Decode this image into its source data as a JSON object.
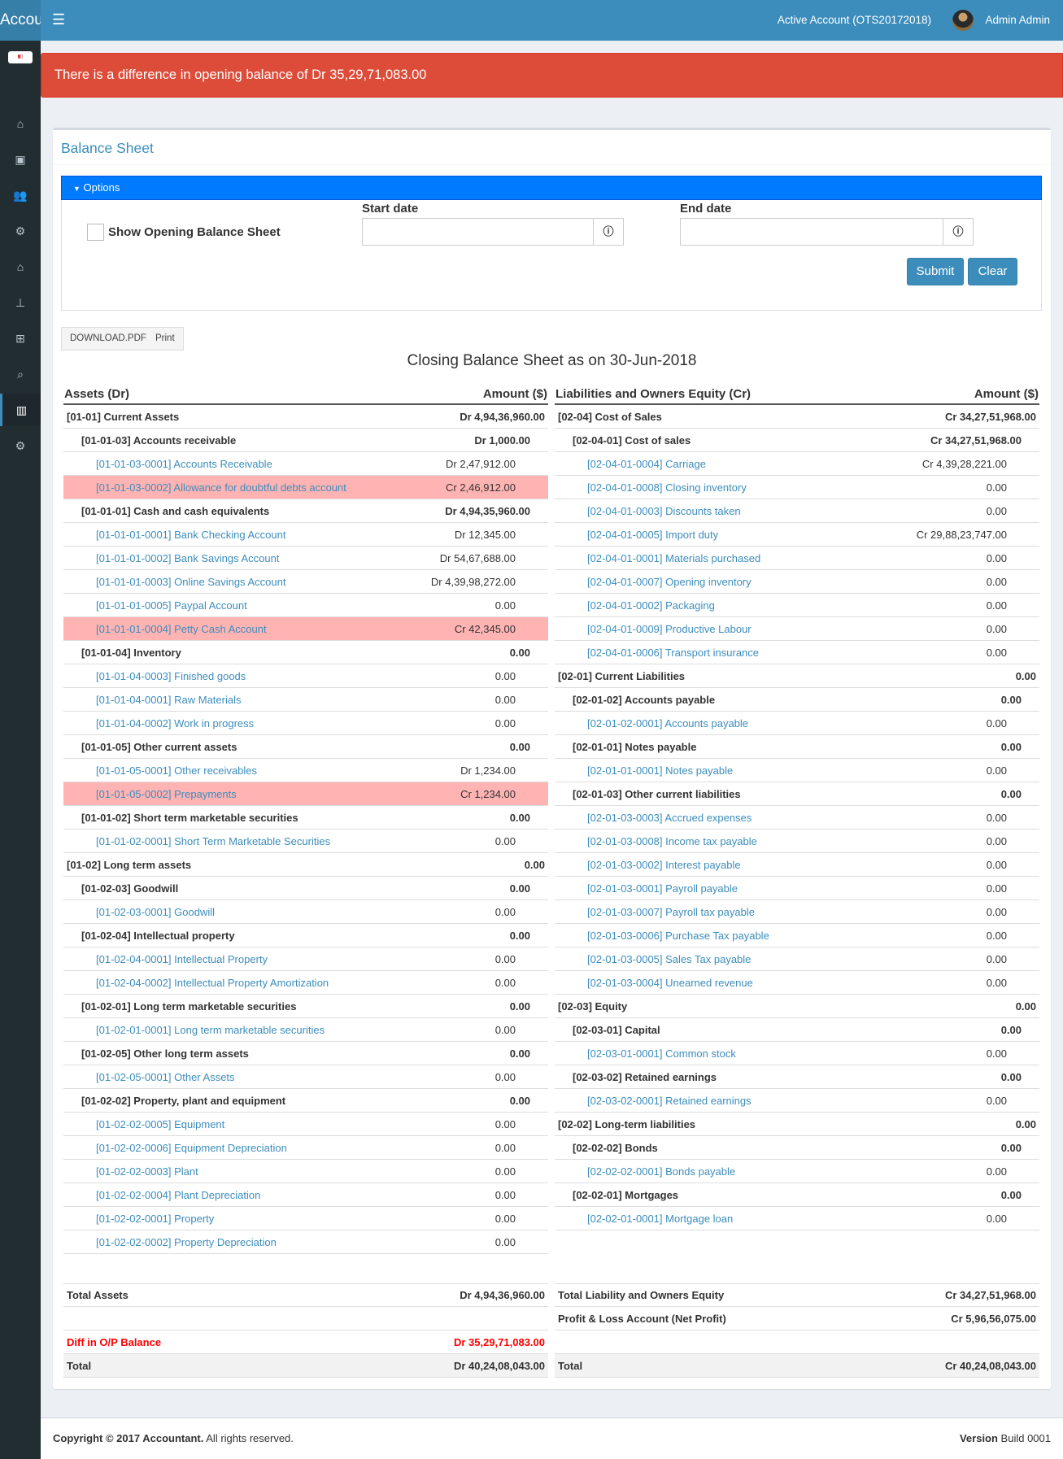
{
  "app": {
    "brand": "Accountant",
    "account": "Active Account (OTS20172018)",
    "user": "Admin Admin",
    "logo_text": "logo"
  },
  "sidebar": {
    "items": [
      {
        "icon": "home-icon",
        "glyph": "⌂"
      },
      {
        "icon": "contacts-icon",
        "glyph": "▣"
      },
      {
        "icon": "users-icon",
        "glyph": "👥"
      },
      {
        "icon": "cogs-icon",
        "glyph": "⚙"
      },
      {
        "icon": "home-icon",
        "glyph": "⌂"
      },
      {
        "icon": "sitemap-icon",
        "glyph": "⊥"
      },
      {
        "icon": "plus-square-icon",
        "glyph": "⊞"
      },
      {
        "icon": "search-icon",
        "glyph": "⌕"
      },
      {
        "icon": "bar-chart-icon",
        "glyph": "▥",
        "active": true
      },
      {
        "icon": "gear-icon",
        "glyph": "⚙"
      }
    ]
  },
  "alert": "There is a difference in opening balance of Dr 35,29,71,083.00",
  "box": {
    "title": "Balance Sheet"
  },
  "options": {
    "label": "Options",
    "show_opening": "Show Opening Balance Sheet",
    "start_label": "Start date",
    "start_value": "",
    "end_label": "End date",
    "end_value": "",
    "submit": "Submit",
    "clear": "Clear"
  },
  "actions": {
    "download": "DOWNLOAD.PDF",
    "print": "Print"
  },
  "sheet_title": "Closing Balance Sheet as on 30-Jun-2018",
  "colors": {
    "accent": "#3c8dbc",
    "alert": "#dd4b39",
    "options": "#007bff",
    "highlight": "#ffb3b3"
  },
  "assets": {
    "header": "Assets (Dr)",
    "amount_header": "Amount ($)",
    "rows": [
      {
        "l": 0,
        "n": "[01-01] Current Assets",
        "a": "Dr 4,94,36,960.00"
      },
      {
        "l": 1,
        "n": "[01-01-03] Accounts receivable",
        "a": "Dr 1,000.00"
      },
      {
        "l": 2,
        "n": "[01-01-03-0001] Accounts Receivable",
        "a": "Dr 2,47,912.00"
      },
      {
        "l": 2,
        "n": "[01-01-03-0002] Allowance for doubtful debts account",
        "a": "Cr 2,46,912.00",
        "hl": true
      },
      {
        "l": 1,
        "n": "[01-01-01] Cash and cash equivalents",
        "a": "Dr 4,94,35,960.00"
      },
      {
        "l": 2,
        "n": "[01-01-01-0001] Bank Checking Account",
        "a": "Dr 12,345.00"
      },
      {
        "l": 2,
        "n": "[01-01-01-0002] Bank Savings Account",
        "a": "Dr 54,67,688.00"
      },
      {
        "l": 2,
        "n": "[01-01-01-0003] Online Savings Account",
        "a": "Dr 4,39,98,272.00"
      },
      {
        "l": 2,
        "n": "[01-01-01-0005] Paypal Account",
        "a": "0.00"
      },
      {
        "l": 2,
        "n": "[01-01-01-0004] Petty Cash Account",
        "a": "Cr 42,345.00",
        "hl": true
      },
      {
        "l": 1,
        "n": "[01-01-04] Inventory",
        "a": "0.00"
      },
      {
        "l": 2,
        "n": "[01-01-04-0003] Finished goods",
        "a": "0.00"
      },
      {
        "l": 2,
        "n": "[01-01-04-0001] Raw Materials",
        "a": "0.00"
      },
      {
        "l": 2,
        "n": "[01-01-04-0002] Work in progress",
        "a": "0.00"
      },
      {
        "l": 1,
        "n": "[01-01-05] Other current assets",
        "a": "0.00"
      },
      {
        "l": 2,
        "n": "[01-01-05-0001] Other receivables",
        "a": "Dr 1,234.00"
      },
      {
        "l": 2,
        "n": "[01-01-05-0002] Prepayments",
        "a": "Cr 1,234.00",
        "hl": true
      },
      {
        "l": 1,
        "n": "[01-01-02] Short term marketable securities",
        "a": "0.00"
      },
      {
        "l": 2,
        "n": "[01-01-02-0001] Short Term Marketable Securities",
        "a": "0.00"
      },
      {
        "l": 0,
        "n": "[01-02] Long term assets",
        "a": "0.00"
      },
      {
        "l": 1,
        "n": "[01-02-03] Goodwill",
        "a": "0.00"
      },
      {
        "l": 2,
        "n": "[01-02-03-0001] Goodwill",
        "a": "0.00"
      },
      {
        "l": 1,
        "n": "[01-02-04] Intellectual property",
        "a": "0.00"
      },
      {
        "l": 2,
        "n": "[01-02-04-0001] Intellectual Property",
        "a": "0.00"
      },
      {
        "l": 2,
        "n": "[01-02-04-0002] Intellectual Property Amortization",
        "a": "0.00"
      },
      {
        "l": 1,
        "n": "[01-02-01] Long term marketable securities",
        "a": "0.00"
      },
      {
        "l": 2,
        "n": "[01-02-01-0001] Long term marketable securities",
        "a": "0.00"
      },
      {
        "l": 1,
        "n": "[01-02-05] Other long term assets",
        "a": "0.00"
      },
      {
        "l": 2,
        "n": "[01-02-05-0001] Other Assets",
        "a": "0.00"
      },
      {
        "l": 1,
        "n": "[01-02-02] Property, plant and equipment",
        "a": "0.00"
      },
      {
        "l": 2,
        "n": "[01-02-02-0005] Equipment",
        "a": "0.00"
      },
      {
        "l": 2,
        "n": "[01-02-02-0006] Equipment Depreciation",
        "a": "0.00"
      },
      {
        "l": 2,
        "n": "[01-02-02-0003] Plant",
        "a": "0.00"
      },
      {
        "l": 2,
        "n": "[01-02-02-0004] Plant Depreciation",
        "a": "0.00"
      },
      {
        "l": 2,
        "n": "[01-02-02-0001] Property",
        "a": "0.00"
      },
      {
        "l": 2,
        "n": "[01-02-02-0002] Property Depreciation",
        "a": "0.00"
      }
    ]
  },
  "liabilities": {
    "header": "Liabilities and Owners Equity (Cr)",
    "amount_header": "Amount ($)",
    "rows": [
      {
        "l": 0,
        "n": "[02-04] Cost of Sales",
        "a": "Cr 34,27,51,968.00"
      },
      {
        "l": 1,
        "n": "[02-04-01] Cost of sales",
        "a": "Cr 34,27,51,968.00"
      },
      {
        "l": 2,
        "n": "[02-04-01-0004] Carriage",
        "a": "Cr 4,39,28,221.00"
      },
      {
        "l": 2,
        "n": "[02-04-01-0008] Closing inventory",
        "a": "0.00"
      },
      {
        "l": 2,
        "n": "[02-04-01-0003] Discounts taken",
        "a": "0.00"
      },
      {
        "l": 2,
        "n": "[02-04-01-0005] Import duty",
        "a": "Cr 29,88,23,747.00"
      },
      {
        "l": 2,
        "n": "[02-04-01-0001] Materials purchased",
        "a": "0.00"
      },
      {
        "l": 2,
        "n": "[02-04-01-0007] Opening inventory",
        "a": "0.00"
      },
      {
        "l": 2,
        "n": "[02-04-01-0002] Packaging",
        "a": "0.00"
      },
      {
        "l": 2,
        "n": "[02-04-01-0009] Productive Labour",
        "a": "0.00"
      },
      {
        "l": 2,
        "n": "[02-04-01-0006] Transport insurance",
        "a": "0.00"
      },
      {
        "l": 0,
        "n": "[02-01] Current Liabilities",
        "a": "0.00"
      },
      {
        "l": 1,
        "n": "[02-01-02] Accounts payable",
        "a": "0.00"
      },
      {
        "l": 2,
        "n": "[02-01-02-0001] Accounts payable",
        "a": "0.00"
      },
      {
        "l": 1,
        "n": "[02-01-01] Notes payable",
        "a": "0.00"
      },
      {
        "l": 2,
        "n": "[02-01-01-0001] Notes payable",
        "a": "0.00"
      },
      {
        "l": 1,
        "n": "[02-01-03] Other current liabilities",
        "a": "0.00"
      },
      {
        "l": 2,
        "n": "[02-01-03-0003] Accrued expenses",
        "a": "0.00"
      },
      {
        "l": 2,
        "n": "[02-01-03-0008] Income tax payable",
        "a": "0.00"
      },
      {
        "l": 2,
        "n": "[02-01-03-0002] Interest payable",
        "a": "0.00"
      },
      {
        "l": 2,
        "n": "[02-01-03-0001] Payroll payable",
        "a": "0.00"
      },
      {
        "l": 2,
        "n": "[02-01-03-0007] Payroll tax payable",
        "a": "0.00"
      },
      {
        "l": 2,
        "n": "[02-01-03-0006] Purchase Tax payable",
        "a": "0.00"
      },
      {
        "l": 2,
        "n": "[02-01-03-0005] Sales Tax payable",
        "a": "0.00"
      },
      {
        "l": 2,
        "n": "[02-01-03-0004] Unearned revenue",
        "a": "0.00"
      },
      {
        "l": 0,
        "n": "[02-03] Equity",
        "a": "0.00"
      },
      {
        "l": 1,
        "n": "[02-03-01] Capital",
        "a": "0.00"
      },
      {
        "l": 2,
        "n": "[02-03-01-0001] Common stock",
        "a": "0.00"
      },
      {
        "l": 1,
        "n": "[02-03-02] Retained earnings",
        "a": "0.00"
      },
      {
        "l": 2,
        "n": "[02-03-02-0001] Retained earnings",
        "a": "0.00"
      },
      {
        "l": 0,
        "n": "[02-02] Long-term liabilities",
        "a": "0.00"
      },
      {
        "l": 1,
        "n": "[02-02-02] Bonds",
        "a": "0.00"
      },
      {
        "l": 2,
        "n": "[02-02-02-0001] Bonds payable",
        "a": "0.00"
      },
      {
        "l": 1,
        "n": "[02-02-01] Mortgages",
        "a": "0.00"
      },
      {
        "l": 2,
        "n": "[02-02-01-0001] Mortgage loan",
        "a": "0.00"
      }
    ]
  },
  "totals": {
    "left": [
      {
        "n": "Total Assets",
        "a": "Dr 4,94,36,960.00"
      },
      {
        "n": "",
        "a": ""
      },
      {
        "n": "Diff in O/P Balance",
        "a": "Dr 35,29,71,083.00",
        "red": true
      },
      {
        "n": "Total",
        "a": "Dr 40,24,08,043.00",
        "grey": true
      }
    ],
    "right": [
      {
        "n": "Total Liability and Owners Equity",
        "a": "Cr 34,27,51,968.00"
      },
      {
        "n": "Profit & Loss Account (Net Profit)",
        "a": "Cr 5,96,56,075.00"
      },
      {
        "n": "",
        "a": ""
      },
      {
        "n": "Total",
        "a": "Cr 40,24,08,043.00",
        "grey": true
      }
    ]
  },
  "footer": {
    "copyright_bold": "Copyright © 2017 Accountant.",
    "copyright_rest": " All rights reserved.",
    "version_bold": "Version",
    "version_rest": " Build 0001"
  }
}
